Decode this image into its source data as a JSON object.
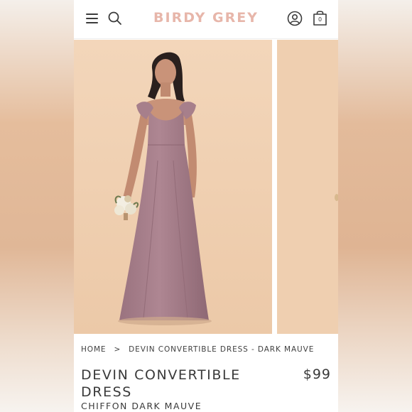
{
  "header": {
    "brand": "BIRDY GREY",
    "bag_count": "0",
    "icons": [
      "menu-icon",
      "search-icon",
      "account-icon",
      "shopping-bag-icon"
    ]
  },
  "gallery": {
    "main_image": "model-in-mauve-dress-photo",
    "next_image": "next-product-photo-partial"
  },
  "breadcrumb": {
    "home": "HOME",
    "separator": ">",
    "current": "DEVIN CONVERTIBLE DRESS - DARK MAUVE"
  },
  "product": {
    "title": "DEVIN CONVERTIBLE DRESS",
    "price": "$99",
    "subtitle": "CHIFFON DARK MAUVE"
  },
  "colors": {
    "brand": "#e7b6aa",
    "text": "#3a3a3a",
    "photo_background": "#f0d2b4",
    "dress_mauve": "#a57e8a"
  }
}
